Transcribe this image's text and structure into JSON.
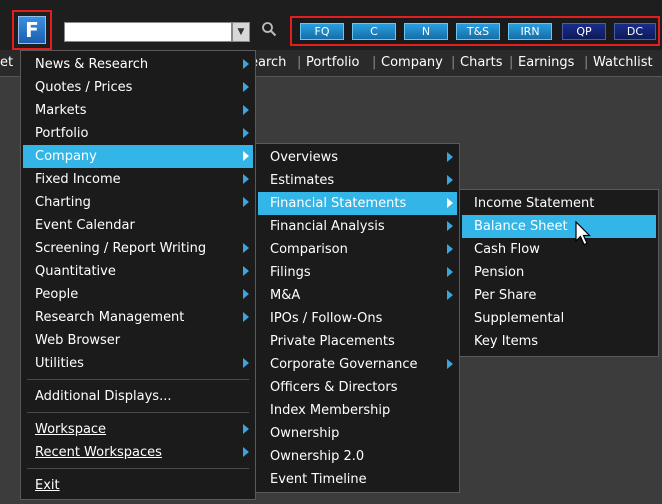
{
  "toolbar": {
    "logo_letter": "F",
    "search_value": "",
    "search_icon": "magnifier-icon",
    "function_keys": [
      {
        "label": "FQ",
        "color": "#2a9ee0"
      },
      {
        "label": "C",
        "color": "#2a9ee0"
      },
      {
        "label": "N",
        "color": "#2a9ee0"
      },
      {
        "label": "T&S",
        "color": "#2a9ee0"
      },
      {
        "label": "IRN",
        "color": "#2a9ee0"
      },
      {
        "label": "QP",
        "color": "#1a2e8a"
      },
      {
        "label": "DC",
        "color": "#1a2e8a"
      }
    ]
  },
  "tabs": [
    "et",
    "earch",
    "Portfolio",
    "Company",
    "Charts",
    "Earnings",
    "Watchlist"
  ],
  "menus": {
    "main": [
      {
        "label": "News & Research",
        "submenu": true
      },
      {
        "label": "Quotes / Prices",
        "submenu": true
      },
      {
        "label": "Markets",
        "submenu": true
      },
      {
        "label": "Portfolio",
        "submenu": true
      },
      {
        "label": "Company",
        "submenu": true,
        "selected": true
      },
      {
        "label": "Fixed Income",
        "submenu": true
      },
      {
        "label": "Charting",
        "submenu": true
      },
      {
        "label": "Event Calendar",
        "submenu": false
      },
      {
        "label": "Screening / Report Writing",
        "submenu": true
      },
      {
        "label": "Quantitative",
        "submenu": true
      },
      {
        "label": "People",
        "submenu": true
      },
      {
        "label": "Research Management",
        "submenu": true
      },
      {
        "label": "Web Browser",
        "submenu": false
      },
      {
        "label": "Utilities",
        "submenu": true
      }
    ],
    "main_extra": {
      "additional_displays": "Additional Displays...",
      "workspace": "Workspace",
      "recent_workspaces": "Recent Workspaces",
      "exit": "Exit"
    },
    "company": [
      {
        "label": "Overviews",
        "submenu": true
      },
      {
        "label": "Estimates",
        "submenu": true
      },
      {
        "label": "Financial Statements",
        "submenu": true,
        "selected": true
      },
      {
        "label": "Financial Analysis",
        "submenu": true
      },
      {
        "label": "Comparison",
        "submenu": true
      },
      {
        "label": "Filings",
        "submenu": true
      },
      {
        "label": "M&A",
        "submenu": true
      },
      {
        "label": "IPOs / Follow-Ons",
        "submenu": false
      },
      {
        "label": "Private Placements",
        "submenu": false
      },
      {
        "label": "Corporate Governance",
        "submenu": true
      },
      {
        "label": "Officers & Directors",
        "submenu": false
      },
      {
        "label": "Index Membership",
        "submenu": false
      },
      {
        "label": "Ownership",
        "submenu": false
      },
      {
        "label": "Ownership 2.0",
        "submenu": false
      },
      {
        "label": "Event Timeline",
        "submenu": false
      }
    ],
    "financial_statements": [
      {
        "label": "Income Statement",
        "selected": false
      },
      {
        "label": "Balance Sheet",
        "selected": true
      },
      {
        "label": "Cash Flow",
        "selected": false
      },
      {
        "label": "Pension",
        "selected": false
      },
      {
        "label": "Per Share",
        "selected": false
      },
      {
        "label": "Supplemental",
        "selected": false
      },
      {
        "label": "Key Items",
        "selected": false
      }
    ]
  },
  "colors": {
    "highlight": "#33b5e8",
    "arrow": "#3aa6e0",
    "menu_bg": "#1b1b1b",
    "accent_red": "#e02020"
  }
}
